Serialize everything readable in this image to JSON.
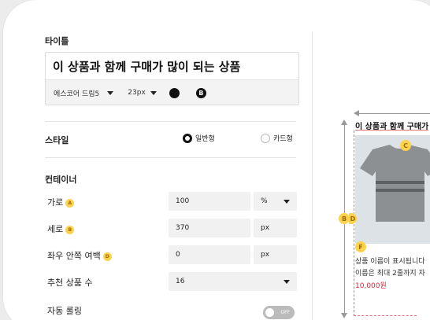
{
  "title_section": {
    "label": "타이틀",
    "input_value": "이 상품과 함께 구매가 많이 되는 상품",
    "font_name": "에스코어 드림5",
    "font_size": "23px",
    "color_badge": "B"
  },
  "style_section": {
    "label": "스타일",
    "options": [
      "일반형",
      "카드형"
    ],
    "selected": "일반형"
  },
  "container": {
    "label": "컨테이너",
    "width": {
      "label": "가로",
      "badge": "A",
      "value": "100",
      "unit": "%"
    },
    "height": {
      "label": "세로",
      "badge": "B",
      "value": "370",
      "unit": "px"
    },
    "padding": {
      "label": "좌우 안쪽 여백",
      "badge": "D",
      "value": "0",
      "unit": "px"
    },
    "count": {
      "label": "추천 상품 수",
      "value": "16"
    },
    "autoroll": {
      "label": "자동 롤링",
      "state": "OFF"
    }
  },
  "preview": {
    "title": "이 상품과 함께 구매가",
    "badge_c": "C",
    "badge_b": "B",
    "badge_d": "D",
    "badge_f": "F",
    "desc1": "상품 이름이 표시됩니다",
    "desc2": "이름은 최대 2줄까지 자",
    "price": "10,000원"
  },
  "colors": {
    "accent": "#fcd24f",
    "price": "#d8283a"
  }
}
